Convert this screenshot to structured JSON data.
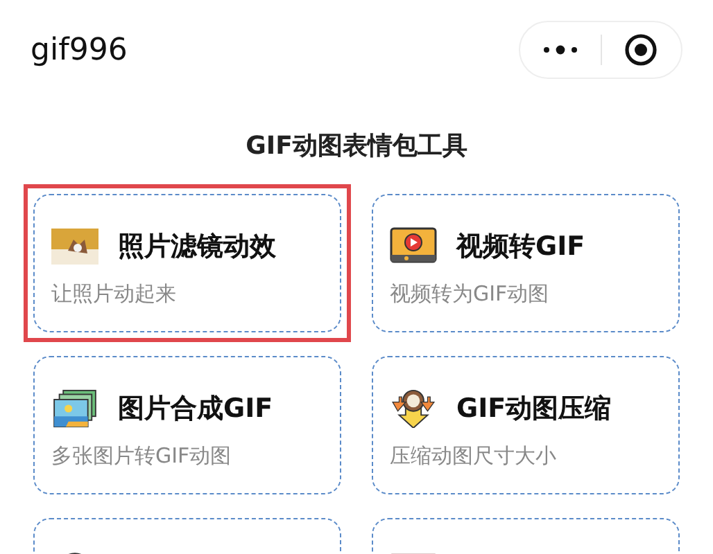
{
  "app_bar": {
    "title": "gif996"
  },
  "heading": "GIF动图表情包工具",
  "cards": [
    {
      "title": "照片滤镜动效",
      "subtitle": "让照片动起来",
      "highlighted": true
    },
    {
      "title": "视频转GIF",
      "subtitle": "视频转为GIF动图",
      "highlighted": false
    },
    {
      "title": "图片合成GIF",
      "subtitle": "多张图片转GIF动图",
      "highlighted": false
    },
    {
      "title": "GIF动图压缩",
      "subtitle": "压缩动图尺寸大小",
      "highlighted": false
    },
    {
      "highlighted": false
    },
    {
      "highlighted": false
    }
  ]
}
